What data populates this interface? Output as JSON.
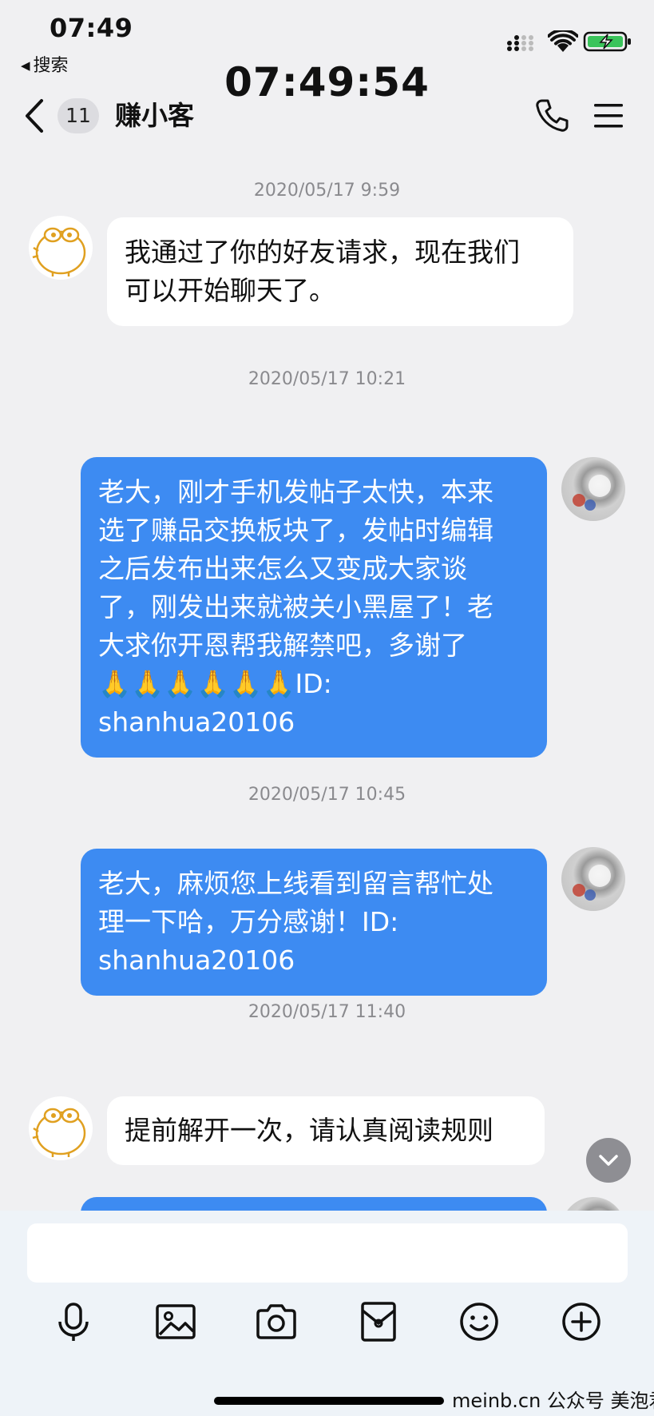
{
  "status_bar": {
    "time": "07:49",
    "back_app": "搜索",
    "overlay_clock": "07:49:54"
  },
  "nav": {
    "unread_count": "11",
    "title": "赚小客"
  },
  "messages": [
    {
      "timestamp": "2020/05/17 9:59",
      "direction": "incoming",
      "lines": [
        "我通过了你的好友请求，现在我们",
        "可以开始聊天了。"
      ]
    },
    {
      "timestamp": "2020/05/17 10:21",
      "direction": "outgoing",
      "lines": [
        "老大，刚才手机发帖子太快，本来",
        "选了赚品交换板块了，发帖时编辑",
        "之后发布出来怎么又变成大家谈",
        "了，刚发出来就被关小黑屋了！老",
        "大求你开恩帮我解禁吧，多谢了",
        "🙏🙏🙏🙏🙏🙏ID:",
        "shanhua20106"
      ]
    },
    {
      "timestamp": "2020/05/17 10:45",
      "direction": "outgoing",
      "lines": [
        "老大，麻烦您上线看到留言帮忙处",
        "理一下哈，万分感谢！ID:",
        "shanhua20106"
      ]
    },
    {
      "timestamp": "2020/05/17 11:40",
      "direction": "incoming",
      "lines": [
        "提前解开一次，请认真阅读规则"
      ]
    }
  ],
  "input": {
    "placeholder": ""
  },
  "toolbar": [
    "microphone-icon",
    "image-icon",
    "camera-icon",
    "red-packet-icon",
    "emoji-icon",
    "plus-icon"
  ],
  "watermark": "meinb.cn  公众号 美泡君",
  "colors": {
    "outgoing_bubble": "#3d8bf2",
    "incoming_bubble": "#ffffff",
    "background": "#f0f0f2"
  }
}
